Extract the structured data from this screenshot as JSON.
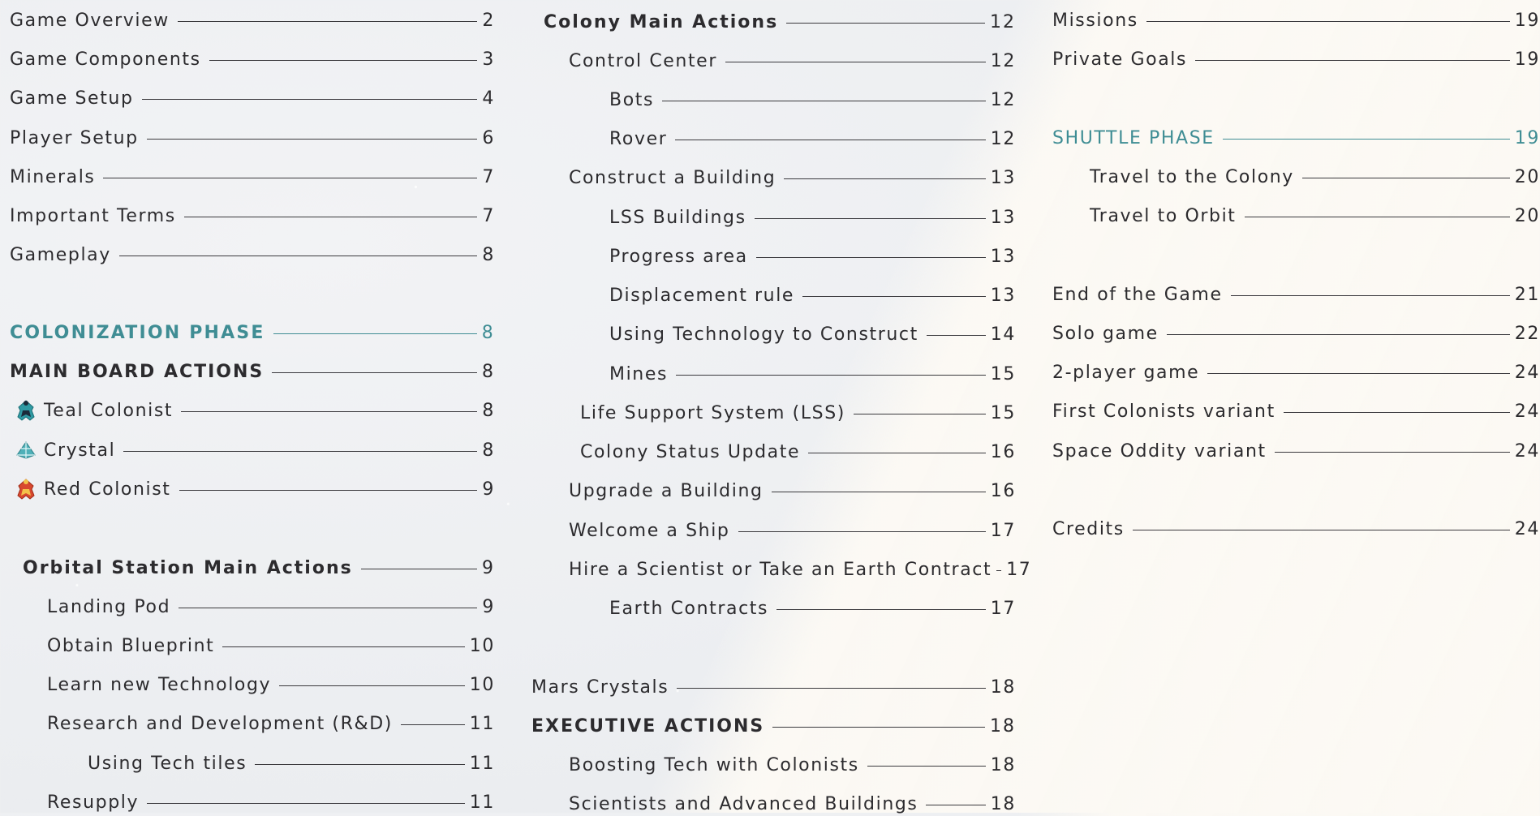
{
  "toc": {
    "col1": [
      {
        "title": "Game Overview",
        "page": "2"
      },
      {
        "title": "Game Components",
        "page": "3"
      },
      {
        "title": "Game Setup",
        "page": "4"
      },
      {
        "title": "Player Setup",
        "page": "6"
      },
      {
        "title": "Minerals",
        "page": "7"
      },
      {
        "title": "Important Terms",
        "page": "7"
      },
      {
        "title": "Gameplay",
        "page": "8"
      },
      {
        "title": "COLONIZATION PHASE",
        "page": "8"
      },
      {
        "title": "MAIN BOARD ACTIONS",
        "page": "8"
      },
      {
        "title": "Teal Colonist",
        "page": "8",
        "icon": "teal-colonist-icon"
      },
      {
        "title": "Crystal",
        "page": "8",
        "icon": "crystal-icon"
      },
      {
        "title": "Red Colonist",
        "page": "9",
        "icon": "red-colonist-icon"
      },
      {
        "title": "Orbital Station Main Actions",
        "page": "9"
      },
      {
        "title": "Landing Pod",
        "page": "9"
      },
      {
        "title": "Obtain Blueprint",
        "page": "10"
      },
      {
        "title": "Learn new Technology",
        "page": "10"
      },
      {
        "title": "Research and Development (R&D)",
        "page": "11"
      },
      {
        "title": "Using Tech tiles",
        "page": "11"
      },
      {
        "title": "Resupply",
        "page": "11"
      }
    ],
    "col2": [
      {
        "title": "Colony Main Actions",
        "page": "12"
      },
      {
        "title": "Control Center",
        "page": "12"
      },
      {
        "title": "Bots",
        "page": "12"
      },
      {
        "title": "Rover",
        "page": "12"
      },
      {
        "title": "Construct a Building",
        "page": "13"
      },
      {
        "title": "LSS Buildings",
        "page": "13"
      },
      {
        "title": "Progress area",
        "page": "13"
      },
      {
        "title": "Displacement rule",
        "page": "13"
      },
      {
        "title": "Using Technology to Construct",
        "page": "14"
      },
      {
        "title": "Mines",
        "page": "15"
      },
      {
        "title": "Life Support System (LSS)",
        "page": "15"
      },
      {
        "title": "Colony Status Update",
        "page": "16"
      },
      {
        "title": "Upgrade a Building",
        "page": "16"
      },
      {
        "title": "Welcome a Ship",
        "page": "17"
      },
      {
        "title": "Hire a Scientist or Take an Earth Contract",
        "page": "17"
      },
      {
        "title": "Earth Contracts",
        "page": "17"
      },
      {
        "title": "Mars Crystals",
        "page": "18"
      },
      {
        "title": "EXECUTIVE ACTIONS",
        "page": "18"
      },
      {
        "title": "Boosting Tech with Colonists",
        "page": "18"
      },
      {
        "title": "Scientists and Advanced Buildings",
        "page": "18"
      }
    ],
    "col3": [
      {
        "title": "Missions",
        "page": "19"
      },
      {
        "title": "Private Goals",
        "page": "19"
      },
      {
        "title": "SHUTTLE PHASE",
        "page": "19"
      },
      {
        "title": "Travel to the Colony",
        "page": "20"
      },
      {
        "title": "Travel to Orbit",
        "page": "20"
      },
      {
        "title": "End of the Game",
        "page": "21"
      },
      {
        "title": "Solo game",
        "page": "22"
      },
      {
        "title": "2-player game",
        "page": "24"
      },
      {
        "title": "First Colonists variant",
        "page": "24"
      },
      {
        "title": "Space Oddity variant",
        "page": "24"
      },
      {
        "title": "Credits",
        "page": "24"
      }
    ]
  },
  "colors": {
    "text": "#2c2b2e",
    "accent_teal": "#3f8d94",
    "icon_teal": "#2f9aa3",
    "icon_red": "#d8482f",
    "icon_crystal": "#4fb0b8"
  }
}
